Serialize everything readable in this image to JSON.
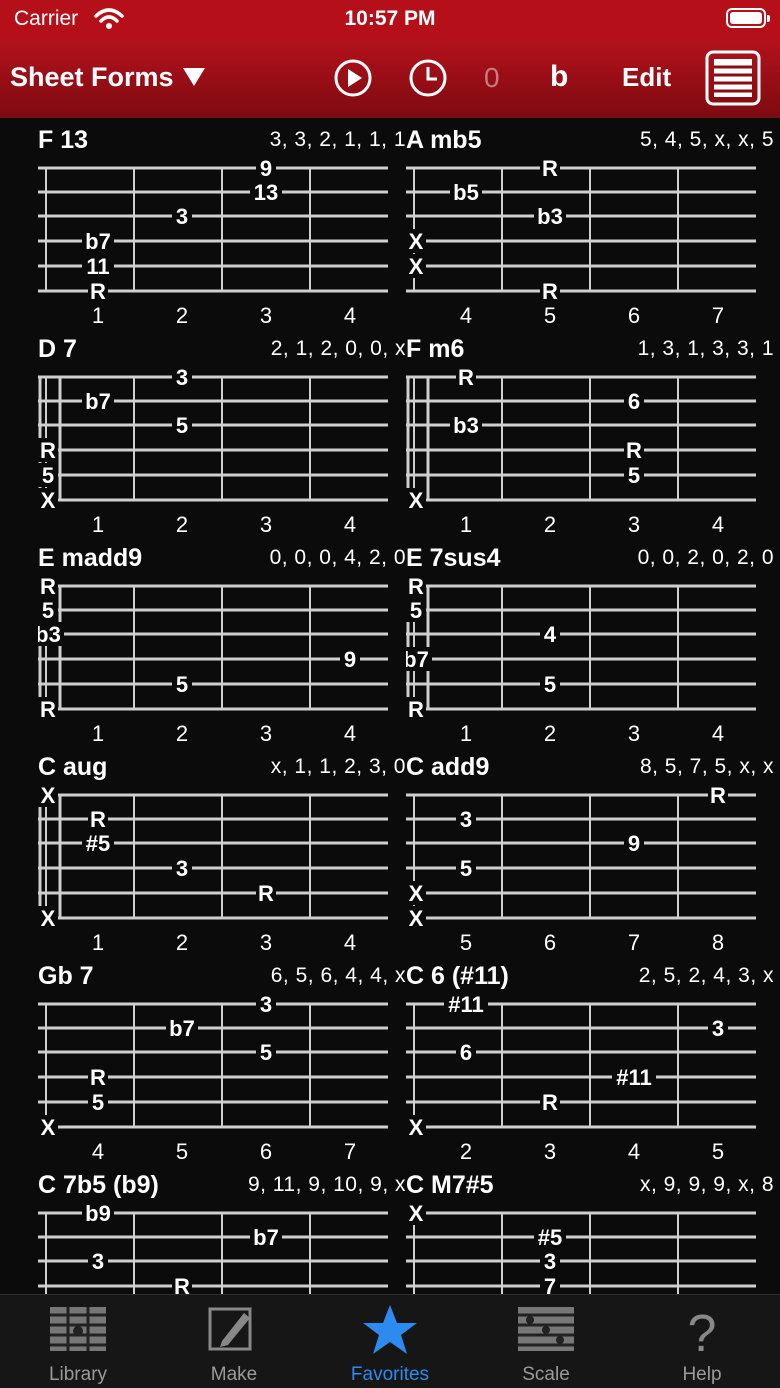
{
  "status": {
    "carrier": "Carrier",
    "time": "10:57 PM"
  },
  "navbar": {
    "title": "Sheet Forms",
    "counter": "0",
    "accidental": "b",
    "edit_label": "Edit"
  },
  "chords": [
    {
      "name": "F 13",
      "fingering": "3, 3, 2, 1, 1, 1",
      "frets": [
        "1",
        "2",
        "3",
        "4"
      ],
      "open": false,
      "notes": [
        {
          "s": 0,
          "f": 3,
          "t": "9"
        },
        {
          "s": 1,
          "f": 3,
          "t": "13"
        },
        {
          "s": 2,
          "f": 2,
          "t": "3"
        },
        {
          "s": 3,
          "f": 1,
          "t": "b7"
        },
        {
          "s": 4,
          "f": 1,
          "t": "11"
        },
        {
          "s": 5,
          "f": 1,
          "t": "R"
        }
      ]
    },
    {
      "name": "A mb5",
      "fingering": "5, 4, 5, x, x, 5",
      "frets": [
        "4",
        "5",
        "6",
        "7"
      ],
      "open": false,
      "notes": [
        {
          "s": 0,
          "f": 2,
          "t": "R"
        },
        {
          "s": 1,
          "f": 1,
          "t": "b5"
        },
        {
          "s": 2,
          "f": 2,
          "t": "b3"
        },
        {
          "s": 3,
          "f": 0,
          "t": "X"
        },
        {
          "s": 4,
          "f": 0,
          "t": "X"
        },
        {
          "s": 5,
          "f": 2,
          "t": "R"
        }
      ]
    },
    {
      "name": "D 7",
      "fingering": "2, 1, 2, 0, 0, x",
      "frets": [
        "1",
        "2",
        "3",
        "4"
      ],
      "open": true,
      "notes": [
        {
          "s": 0,
          "f": 2,
          "t": "3"
        },
        {
          "s": 1,
          "f": 1,
          "t": "b7"
        },
        {
          "s": 2,
          "f": 2,
          "t": "5"
        },
        {
          "s": 3,
          "f": 0,
          "t": "R"
        },
        {
          "s": 4,
          "f": 0,
          "t": "5"
        },
        {
          "s": 5,
          "f": 0,
          "t": "X"
        }
      ]
    },
    {
      "name": "F m6",
      "fingering": "1, 3, 1, 3, 3, 1",
      "frets": [
        "1",
        "2",
        "3",
        "4"
      ],
      "open": true,
      "notes": [
        {
          "s": 0,
          "f": 1,
          "t": "R"
        },
        {
          "s": 1,
          "f": 3,
          "t": "6"
        },
        {
          "s": 2,
          "f": 1,
          "t": "b3"
        },
        {
          "s": 3,
          "f": 3,
          "t": "R"
        },
        {
          "s": 4,
          "f": 3,
          "t": "5"
        },
        {
          "s": 5,
          "f": 0,
          "t": "X"
        }
      ]
    },
    {
      "name": "E madd9",
      "fingering": "0, 0, 0, 4, 2, 0",
      "frets": [
        "1",
        "2",
        "3",
        "4"
      ],
      "open": true,
      "notes": [
        {
          "s": 0,
          "f": 0,
          "t": "R"
        },
        {
          "s": 1,
          "f": 0,
          "t": "5"
        },
        {
          "s": 2,
          "f": 0,
          "t": "b3"
        },
        {
          "s": 3,
          "f": 4,
          "t": "9"
        },
        {
          "s": 4,
          "f": 2,
          "t": "5"
        },
        {
          "s": 5,
          "f": 0,
          "t": "R"
        }
      ]
    },
    {
      "name": "E 7sus4",
      "fingering": "0, 0, 2, 0, 2, 0",
      "frets": [
        "1",
        "2",
        "3",
        "4"
      ],
      "open": true,
      "notes": [
        {
          "s": 0,
          "f": 0,
          "t": "R"
        },
        {
          "s": 1,
          "f": 0,
          "t": "5"
        },
        {
          "s": 2,
          "f": 2,
          "t": "4"
        },
        {
          "s": 3,
          "f": 0,
          "t": "b7"
        },
        {
          "s": 4,
          "f": 2,
          "t": "5"
        },
        {
          "s": 5,
          "f": 0,
          "t": "R"
        }
      ]
    },
    {
      "name": "C aug",
      "fingering": "x, 1, 1, 2, 3, 0",
      "frets": [
        "1",
        "2",
        "3",
        "4"
      ],
      "open": true,
      "notes": [
        {
          "s": 0,
          "f": 0,
          "t": "X"
        },
        {
          "s": 1,
          "f": 1,
          "t": "R"
        },
        {
          "s": 2,
          "f": 1,
          "t": "#5"
        },
        {
          "s": 3,
          "f": 2,
          "t": "3"
        },
        {
          "s": 4,
          "f": 3,
          "t": "R"
        },
        {
          "s": 5,
          "f": 0,
          "t": "X"
        }
      ]
    },
    {
      "name": "C add9",
      "fingering": "8, 5, 7, 5, x, x",
      "frets": [
        "5",
        "6",
        "7",
        "8"
      ],
      "open": false,
      "notes": [
        {
          "s": 0,
          "f": 4,
          "t": "R"
        },
        {
          "s": 1,
          "f": 1,
          "t": "3"
        },
        {
          "s": 2,
          "f": 3,
          "t": "9"
        },
        {
          "s": 3,
          "f": 1,
          "t": "5"
        },
        {
          "s": 4,
          "f": 0,
          "t": "X"
        },
        {
          "s": 5,
          "f": 0,
          "t": "X"
        }
      ]
    },
    {
      "name": "Gb 7",
      "fingering": "6, 5, 6, 4, 4, x",
      "frets": [
        "4",
        "5",
        "6",
        "7"
      ],
      "open": false,
      "notes": [
        {
          "s": 0,
          "f": 3,
          "t": "3"
        },
        {
          "s": 1,
          "f": 2,
          "t": "b7"
        },
        {
          "s": 2,
          "f": 3,
          "t": "5"
        },
        {
          "s": 3,
          "f": 1,
          "t": "R"
        },
        {
          "s": 4,
          "f": 1,
          "t": "5"
        },
        {
          "s": 5,
          "f": 0,
          "t": "X"
        }
      ]
    },
    {
      "name": "C 6 (#11)",
      "fingering": "2, 5, 2, 4, 3, x",
      "frets": [
        "2",
        "3",
        "4",
        "5"
      ],
      "open": false,
      "notes": [
        {
          "s": 0,
          "f": 1,
          "t": "#11"
        },
        {
          "s": 1,
          "f": 4,
          "t": "3"
        },
        {
          "s": 2,
          "f": 1,
          "t": "6"
        },
        {
          "s": 3,
          "f": 3,
          "t": "#11"
        },
        {
          "s": 4,
          "f": 2,
          "t": "R"
        },
        {
          "s": 5,
          "f": 0,
          "t": "X"
        }
      ]
    },
    {
      "name": "C 7b5 (b9)",
      "fingering": "9, 11, 9, 10, 9, x",
      "frets": [
        "",
        "",
        "",
        ""
      ],
      "open": false,
      "notes": [
        {
          "s": 0,
          "f": 1,
          "t": "b9"
        },
        {
          "s": 1,
          "f": 3,
          "t": "b7"
        },
        {
          "s": 2,
          "f": 1,
          "t": "3"
        },
        {
          "s": 3,
          "f": 2,
          "t": "R"
        }
      ]
    },
    {
      "name": "C M7#5",
      "fingering": "x, 9, 9, 9, x, 8",
      "frets": [
        "",
        "",
        "",
        ""
      ],
      "open": false,
      "notes": [
        {
          "s": 0,
          "f": 0,
          "t": "X"
        },
        {
          "s": 1,
          "f": 2,
          "t": "#5"
        },
        {
          "s": 2,
          "f": 2,
          "t": "3"
        },
        {
          "s": 3,
          "f": 2,
          "t": "7"
        }
      ]
    }
  ],
  "tabs": [
    {
      "label": "Library",
      "icon": "library-icon",
      "active": false
    },
    {
      "label": "Make",
      "icon": "pencil-icon",
      "active": false
    },
    {
      "label": "Favorites",
      "icon": "star-icon",
      "active": true
    },
    {
      "label": "Scale",
      "icon": "scale-icon",
      "active": false
    },
    {
      "label": "Help",
      "icon": "help-icon",
      "active": false
    }
  ],
  "colors": {
    "accent": "#b5101a",
    "tab_active": "#2d8bf0"
  }
}
